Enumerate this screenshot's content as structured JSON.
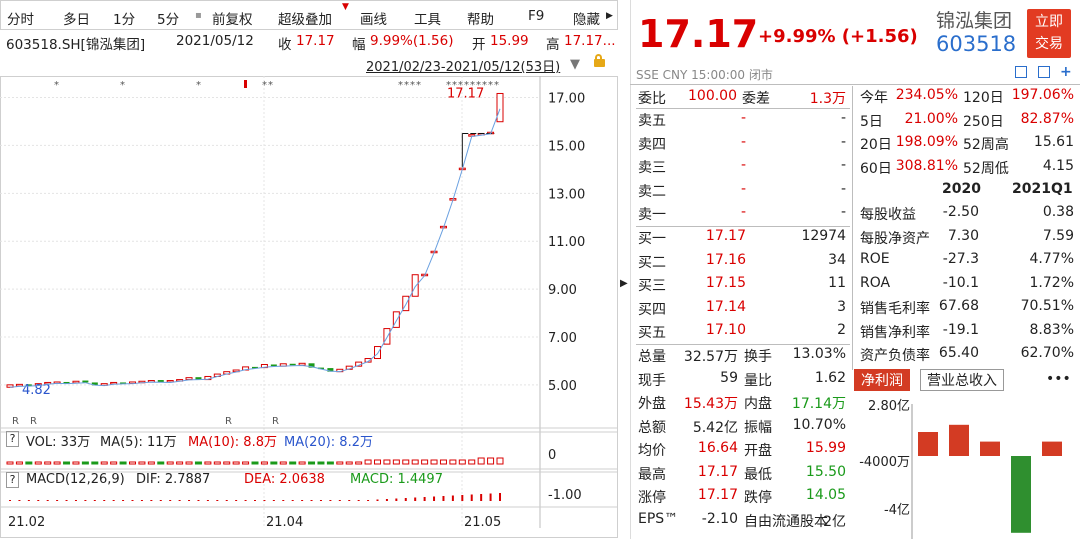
{
  "toolbar": {
    "items": [
      "分时",
      "多日",
      "1分",
      "5分",
      "前复权",
      "超级叠加",
      "画线",
      "工具",
      "帮助",
      "F9",
      "隐藏"
    ]
  },
  "info": {
    "symbol": "603518.SH[锦泓集团]",
    "date": "2021/05/12",
    "close_label": "收",
    "close": "17.17",
    "range_label": "幅",
    "range": "9.99%(1.56)",
    "open_label": "开",
    "open": "15.99",
    "high_label": "高",
    "high": "17.17..."
  },
  "range_text": "2021/02/23-2021/05/12(53日)",
  "chart_data": {
    "type": "candlestick",
    "y_ticks": [
      "17.00",
      "15.00",
      "13.00",
      "11.00",
      "9.00",
      "7.00",
      "5.00"
    ],
    "y_values": [
      17,
      15,
      13,
      11,
      9,
      7,
      5
    ],
    "ylim": [
      4.2,
      17.9
    ],
    "x_ticks": [
      "21.02",
      "21.04",
      "21.05"
    ],
    "last_price_label": "17.17",
    "start_price_label": "4.82",
    "markers": [
      "R",
      "R",
      "R",
      "R"
    ],
    "candles": [
      {
        "o": 4.9,
        "c": 5.0
      },
      {
        "o": 4.95,
        "c": 5.02
      },
      {
        "o": 5.02,
        "c": 4.97
      },
      {
        "o": 4.98,
        "c": 5.05
      },
      {
        "o": 5.05,
        "c": 5.1
      },
      {
        "o": 5.1,
        "c": 5.12
      },
      {
        "o": 5.12,
        "c": 5.08
      },
      {
        "o": 5.08,
        "c": 5.15
      },
      {
        "o": 5.18,
        "c": 5.1
      },
      {
        "o": 5.1,
        "c": 4.98
      },
      {
        "o": 4.98,
        "c": 5.05
      },
      {
        "o": 5.05,
        "c": 5.1
      },
      {
        "o": 5.1,
        "c": 5.08
      },
      {
        "o": 5.08,
        "c": 5.12
      },
      {
        "o": 5.12,
        "c": 5.15
      },
      {
        "o": 5.15,
        "c": 5.18
      },
      {
        "o": 5.2,
        "c": 5.12
      },
      {
        "o": 5.12,
        "c": 5.18
      },
      {
        "o": 5.18,
        "c": 5.22
      },
      {
        "o": 5.22,
        "c": 5.3
      },
      {
        "o": 5.32,
        "c": 5.22
      },
      {
        "o": 5.22,
        "c": 5.35
      },
      {
        "o": 5.35,
        "c": 5.45
      },
      {
        "o": 5.45,
        "c": 5.55
      },
      {
        "o": 5.55,
        "c": 5.62
      },
      {
        "o": 5.62,
        "c": 5.75
      },
      {
        "o": 5.75,
        "c": 5.72
      },
      {
        "o": 5.72,
        "c": 5.85
      },
      {
        "o": 5.85,
        "c": 5.78
      },
      {
        "o": 5.78,
        "c": 5.88
      },
      {
        "o": 5.88,
        "c": 5.82
      },
      {
        "o": 5.82,
        "c": 5.9
      },
      {
        "o": 5.9,
        "c": 5.72
      },
      {
        "o": 5.72,
        "c": 5.7
      },
      {
        "o": 5.7,
        "c": 5.55
      },
      {
        "o": 5.55,
        "c": 5.65
      },
      {
        "o": 5.65,
        "c": 5.78
      },
      {
        "o": 5.78,
        "c": 5.95
      },
      {
        "o": 5.95,
        "c": 6.1
      },
      {
        "o": 6.1,
        "c": 6.6
      },
      {
        "o": 6.7,
        "c": 7.35
      },
      {
        "o": 7.4,
        "c": 8.05
      },
      {
        "o": 8.1,
        "c": 8.7
      },
      {
        "o": 8.7,
        "c": 9.6
      },
      {
        "o": 9.6,
        "c": 9.62
      },
      {
        "o": 10.55,
        "c": 10.58
      },
      {
        "o": 11.6,
        "c": 11.62
      },
      {
        "o": 12.75,
        "c": 12.78
      },
      {
        "o": 14.05,
        "c": 14.05
      },
      {
        "o": 15.4,
        "c": 15.45
      },
      {
        "o": 15.45,
        "c": 15.5
      },
      {
        "o": 15.52,
        "c": 15.55
      },
      {
        "o": 15.99,
        "c": 17.17
      }
    ]
  },
  "vol": {
    "label": "VOL: 33万",
    "ma5": "MA(5): 11万",
    "ma10": "MA(10): 8.8万",
    "ma20": "MA(20): 8.2万",
    "tick": "0"
  },
  "macd": {
    "label": "MACD(12,26,9)",
    "dif": "DIF: 2.7887",
    "dea": "DEA: 2.0638",
    "macd": "MACD: 1.4497",
    "tick": "-1.00"
  },
  "quote": {
    "price": "17.17",
    "change": "+9.99% (+1.56)",
    "name": "锦泓集团",
    "code": "603518",
    "trade_button": [
      "立即",
      "交易"
    ],
    "market": "SSE  CNY  15:00:00  闭市"
  },
  "orderbook": {
    "weibi": {
      "label": "委比",
      "value": "100.00",
      "label2": "委差",
      "value2": "1.3万"
    },
    "asks": [
      {
        "label": "卖五",
        "price": "-",
        "vol": "-"
      },
      {
        "label": "卖四",
        "price": "-",
        "vol": "-"
      },
      {
        "label": "卖三",
        "price": "-",
        "vol": "-"
      },
      {
        "label": "卖二",
        "price": "-",
        "vol": "-"
      },
      {
        "label": "卖一",
        "price": "-",
        "vol": "-"
      }
    ],
    "bids": [
      {
        "label": "买一",
        "price": "17.17",
        "vol": "12974"
      },
      {
        "label": "买二",
        "price": "17.16",
        "vol": "34"
      },
      {
        "label": "买三",
        "price": "17.15",
        "vol": "11"
      },
      {
        "label": "买四",
        "price": "17.14",
        "vol": "3"
      },
      {
        "label": "买五",
        "price": "17.10",
        "vol": "2"
      }
    ]
  },
  "stats": [
    {
      "l1": "总量",
      "v1": "32.57万",
      "c1": "",
      "l2": "换手",
      "v2": "13.03%",
      "c2": ""
    },
    {
      "l1": "现手",
      "v1": "59",
      "c1": "",
      "l2": "量比",
      "v2": "1.62",
      "c2": ""
    },
    {
      "l1": "外盘",
      "v1": "15.43万",
      "c1": "r",
      "l2": "内盘",
      "v2": "17.14万",
      "c2": "g"
    },
    {
      "l1": "总额",
      "v1": "5.42亿",
      "c1": "",
      "l2": "振幅",
      "v2": "10.70%",
      "c2": ""
    },
    {
      "l1": "均价",
      "v1": "16.64",
      "c1": "r",
      "l2": "开盘",
      "v2": "15.99",
      "c2": "r"
    },
    {
      "l1": "最高",
      "v1": "17.17",
      "c1": "r",
      "l2": "最低",
      "v2": "15.50",
      "c2": "g"
    },
    {
      "l1": "涨停",
      "v1": "17.17",
      "c1": "r",
      "l2": "跌停",
      "v2": "14.05",
      "c2": "g"
    },
    {
      "l1": "EPS™",
      "v1": "-2.10",
      "c1": "",
      "l2": "自由流通股本",
      "v2": "2亿",
      "c2": ""
    }
  ],
  "perf": [
    {
      "l1": "今年",
      "v1": "234.05%",
      "l2": "120日",
      "v2": "197.06%"
    },
    {
      "l1": "5日",
      "v1": "21.00%",
      "l2": "250日",
      "v2": "82.87%"
    },
    {
      "l1": "20日",
      "v1": "198.09%",
      "l2": "52周高",
      "v2": "15.61"
    },
    {
      "l1": "60日",
      "v1": "308.81%",
      "l2": "52周低",
      "v2": "4.15"
    }
  ],
  "fin": {
    "years": [
      "2020",
      "2021Q1"
    ],
    "rows": [
      {
        "label": "每股收益",
        "a": "-2.50",
        "b": "0.38"
      },
      {
        "label": "每股净资产",
        "a": "7.30",
        "b": "7.59"
      },
      {
        "label": "ROE",
        "a": "-27.3",
        "b": "4.77%"
      },
      {
        "label": "ROA",
        "a": "-10.1",
        "b": "1.72%"
      },
      {
        "label": "销售毛利率",
        "a": "67.68",
        "b": "70.51%"
      },
      {
        "label": "销售净利率",
        "a": "-19.1",
        "b": "8.83%"
      },
      {
        "label": "资产负债率",
        "a": "65.40",
        "b": "62.70%"
      }
    ]
  },
  "tabs": [
    "净利润",
    "营业总收入"
  ],
  "more": "•••",
  "bar_chart": {
    "ticks": [
      "2.80亿",
      "-4000万",
      "-4亿"
    ],
    "values": [
      1.0,
      1.3,
      0.6,
      -3.2,
      0.6
    ],
    "colors": [
      "#d33b23",
      "#d33b23",
      "#d33b23",
      "#2f8f2f",
      "#d33b23"
    ]
  },
  "colors": {
    "up": "#d90000",
    "down": "#1a9a1a",
    "accent": "#e23b22",
    "blue": "#2a6ecc"
  }
}
